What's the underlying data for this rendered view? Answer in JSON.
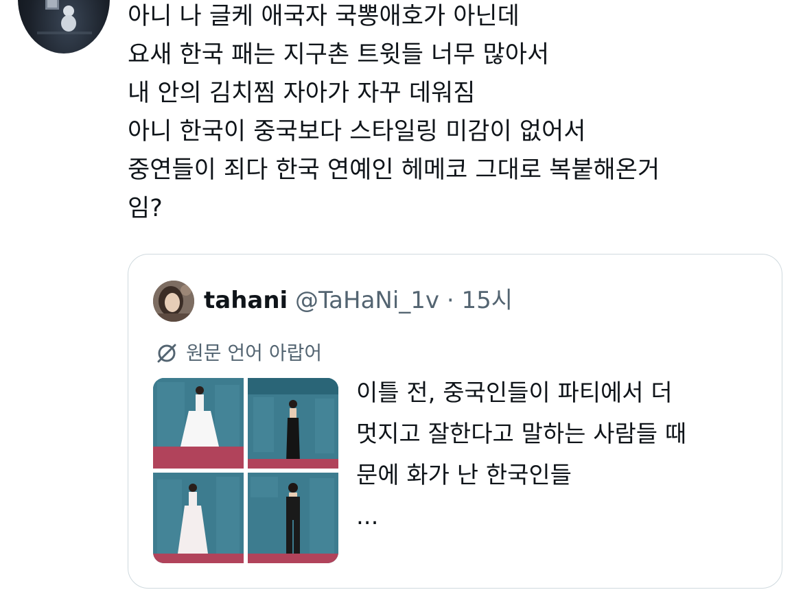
{
  "tweet": {
    "avatar_icon": "user-avatar",
    "text": "아니 나 글케 애국자 국뽕애호가 아닌데\n요새 한국 패는 지구촌 트윗들 너무 많아서\n내 안의 김치찜 자아가 자꾸 데워짐\n아니 한국이 중국보다 스타일링 미감이 없어서\n중연들이 죄다 한국 연예인 헤메코 그대로 복붙해온거\n임?"
  },
  "quote": {
    "author_name": "tahani",
    "handle": "@TaHaNi_1v",
    "separator": "·",
    "time": "15시",
    "translate_label": "원문 언어 아랍어",
    "text": "이틀 전, 중국인들이 파티에서 더\n멋지고 잘한다고 말하는 사람들 때\n문에 화가 난 한국인들",
    "ellipsis": "...",
    "media": [
      {
        "kind": "white-gown-photo"
      },
      {
        "kind": "black-halter-dress-photo"
      },
      {
        "kind": "white-gown-photo-2"
      },
      {
        "kind": "black-suit-photo"
      }
    ]
  },
  "colors": {
    "text": "#0f1419",
    "secondary": "#536471",
    "border": "#cfd9de",
    "backdrop": "#2f6f82"
  }
}
